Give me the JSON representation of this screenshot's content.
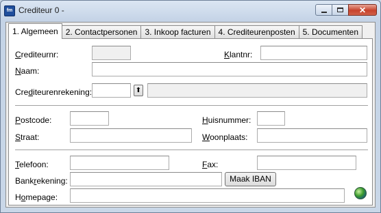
{
  "window": {
    "title": "Crediteur 0 -",
    "icon_text": "fm",
    "minimize_icon": "minimize-icon",
    "maximize_icon": "maximize-icon",
    "close_label": "✕"
  },
  "tabs": [
    {
      "label": "1. Algemeen",
      "active": true
    },
    {
      "label": "2. Contactpersonen",
      "active": false
    },
    {
      "label": "3. Inkoop facturen",
      "active": false
    },
    {
      "label": "4. Crediteurenposten",
      "active": false
    },
    {
      "label": "5. Documenten",
      "active": false
    }
  ],
  "form": {
    "crediteurnr": {
      "label_pre": "",
      "label_key": "C",
      "label_post": "rediteurnr:",
      "value": ""
    },
    "klantnr": {
      "label_pre": "",
      "label_key": "K",
      "label_post": "lantnr:",
      "value": ""
    },
    "naam": {
      "label_pre": "",
      "label_key": "N",
      "label_post": "aam:",
      "value": ""
    },
    "crediteurenrekening": {
      "label_pre": "Cre",
      "label_key": "d",
      "label_post": "iteurenrekening:",
      "value": "",
      "description": ""
    },
    "postcode": {
      "label_pre": "",
      "label_key": "P",
      "label_post": "ostcode:",
      "value": ""
    },
    "huisnummer": {
      "label_pre": "",
      "label_key": "H",
      "label_post": "uisnummer:",
      "value": ""
    },
    "straat": {
      "label_pre": "",
      "label_key": "S",
      "label_post": "traat:",
      "value": ""
    },
    "woonplaats": {
      "label_pre": "",
      "label_key": "W",
      "label_post": "oonplaats:",
      "value": ""
    },
    "telefoon": {
      "label_pre": "",
      "label_key": "T",
      "label_post": "elefoon:",
      "value": ""
    },
    "fax": {
      "label_pre": "",
      "label_key": "F",
      "label_post": "ax:",
      "value": ""
    },
    "bankrekening": {
      "label_pre": "Bank",
      "label_key": "r",
      "label_post": "ekening:",
      "value": ""
    },
    "homepage": {
      "label_pre": "H",
      "label_key": "o",
      "label_post": "mepage:",
      "value": ""
    },
    "maak_iban_label": "Maak IBAN",
    "upload_glyph": "⬆"
  }
}
